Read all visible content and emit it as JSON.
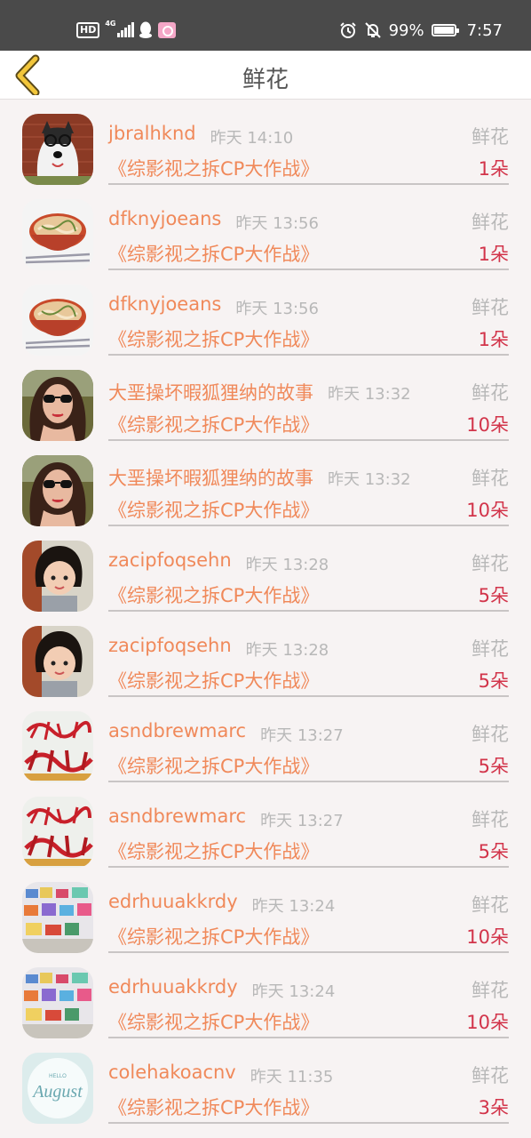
{
  "status_bar": {
    "hd": "HD",
    "network": "4G",
    "battery": "99%",
    "battery_level": 0.99,
    "time": "7:57"
  },
  "header": {
    "title": "鲜花"
  },
  "rows": [
    {
      "name": "jbralhknd",
      "time": "昨天 14:10",
      "gift": "鲜花",
      "show": "《综影视之拆CP大作战》",
      "count": "1朵",
      "avatar": "dog-photo"
    },
    {
      "name": "dfknyjoeans",
      "time": "昨天 13:56",
      "gift": "鲜花",
      "show": "《综影视之拆CP大作战》",
      "count": "1朵",
      "avatar": "noodle-bowl"
    },
    {
      "name": "dfknyjoeans",
      "time": "昨天 13:56",
      "gift": "鲜花",
      "show": "《综影视之拆CP大作战》",
      "count": "1朵",
      "avatar": "noodle-bowl"
    },
    {
      "name": "大垩操坏暇狐狸纳的故事",
      "time": "昨天 13:32",
      "gift": "鲜花",
      "show": "《综影视之拆CP大作战》",
      "count": "10朵",
      "avatar": "woman-sunglasses"
    },
    {
      "name": "大垩操坏暇狐狸纳的故事",
      "time": "昨天 13:32",
      "gift": "鲜花",
      "show": "《综影视之拆CP大作战》",
      "count": "10朵",
      "avatar": "woman-sunglasses"
    },
    {
      "name": "zacipfoqsehn",
      "time": "昨天 13:28",
      "gift": "鲜花",
      "show": "《综影视之拆CP大作战》",
      "count": "5朵",
      "avatar": "child-portrait"
    },
    {
      "name": "zacipfoqsehn",
      "time": "昨天 13:28",
      "gift": "鲜花",
      "show": "《综影视之拆CP大作战》",
      "count": "5朵",
      "avatar": "child-portrait"
    },
    {
      "name": "asndbrewmarc",
      "time": "昨天 13:27",
      "gift": "鲜花",
      "show": "《综影视之拆CP大作战》",
      "count": "5朵",
      "avatar": "red-calligraphy"
    },
    {
      "name": "asndbrewmarc",
      "time": "昨天 13:27",
      "gift": "鲜花",
      "show": "《综影视之拆CP大作战》",
      "count": "5朵",
      "avatar": "red-calligraphy"
    },
    {
      "name": "edrhuuakkrdy",
      "time": "昨天 13:24",
      "gift": "鲜花",
      "show": "《综影视之拆CP大作战》",
      "count": "10朵",
      "avatar": "colorful-boxes"
    },
    {
      "name": "edrhuuakkrdy",
      "time": "昨天 13:24",
      "gift": "鲜花",
      "show": "《综影视之拆CP大作战》",
      "count": "10朵",
      "avatar": "colorful-boxes"
    },
    {
      "name": "colehakoacnv",
      "time": "昨天 11:35",
      "gift": "鲜花",
      "show": "《综影视之拆CP大作战》",
      "count": "3朵",
      "avatar": "august-card"
    }
  ],
  "avatar_logos": {
    "august": "August",
    "august_hello": "HELLO"
  }
}
